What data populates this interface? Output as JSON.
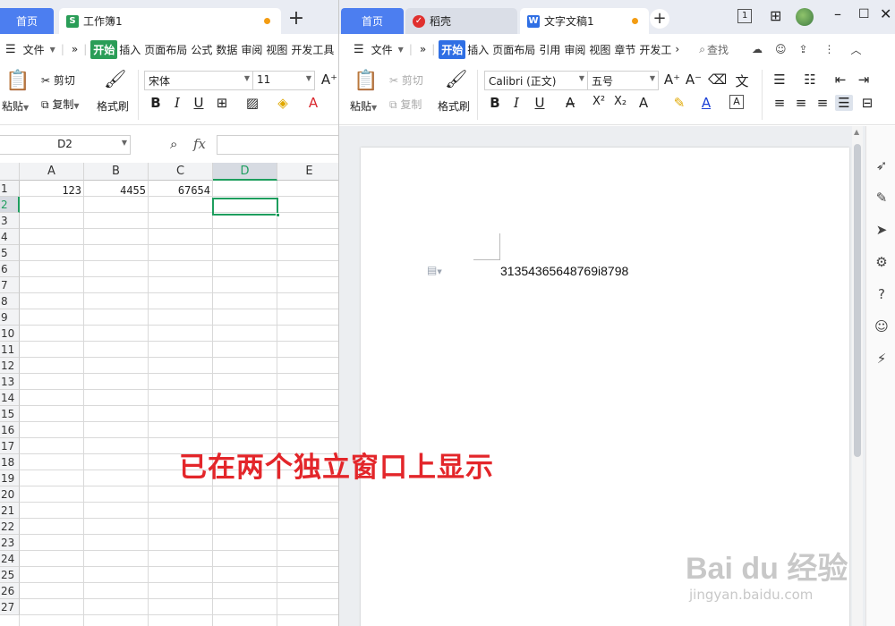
{
  "left_window": {
    "tabs": {
      "home": "首页",
      "doc": "工作簿1"
    },
    "menu": {
      "file": "文件",
      "more": "»",
      "items": [
        "开始",
        "插入",
        "页面布局",
        "公式",
        "数据",
        "审阅",
        "视图",
        "开发工具"
      ]
    },
    "ribbon": {
      "paste": "粘贴",
      "cut": "剪切",
      "copy": "复制",
      "format_painter": "格式刷",
      "font": "宋体",
      "size": "11"
    },
    "name_box": "D2",
    "fx": "fx",
    "columns": [
      "A",
      "B",
      "C",
      "D",
      "E"
    ],
    "rows": [
      "1",
      "2",
      "3",
      "4",
      "5",
      "6",
      "7",
      "8",
      "9",
      "10",
      "11",
      "12",
      "13",
      "14",
      "15",
      "16",
      "17",
      "18",
      "19",
      "20",
      "21",
      "22",
      "23",
      "24",
      "25",
      "26",
      "27"
    ],
    "cells": {
      "A1": "123",
      "B1": "4455",
      "C1": "67654"
    }
  },
  "right_window": {
    "tabs": {
      "home": "首页",
      "daoke": "稻壳",
      "doc": "文字文稿1"
    },
    "menu": {
      "file": "文件",
      "more": "»",
      "items": [
        "开始",
        "插入",
        "页面布局",
        "引用",
        "审阅",
        "视图",
        "章节",
        "开发工"
      ],
      "search": "查找"
    },
    "ribbon": {
      "paste": "粘贴",
      "cut": "剪切",
      "copy": "复制",
      "format_painter": "格式刷",
      "font": "Calibri (正文)",
      "size": "五号"
    },
    "document_text": "31354365648769i8798",
    "badge_count": "1"
  },
  "overlay_caption": "已在两个独立窗口上显示",
  "watermark": {
    "brand": "Bai du 经验",
    "url": "jingyan.baidu.com"
  },
  "colors": {
    "accent_blue": "#4c7ef0",
    "excel_green": "#2a9d57",
    "caption_red": "#e3262a",
    "selection_green": "#1e9e5e"
  }
}
